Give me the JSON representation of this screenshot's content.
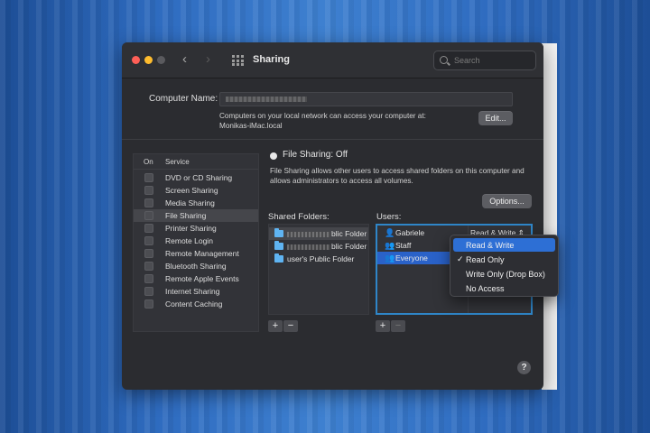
{
  "window": {
    "title": "Sharing",
    "search_placeholder": "Search"
  },
  "computer_name": {
    "label": "Computer Name:",
    "value": "",
    "description_line1": "Computers on your local network can access your computer at:",
    "description_line2": "Monikas-iMac.local",
    "edit_label": "Edit..."
  },
  "services": {
    "header_on": "On",
    "header_service": "Service",
    "items": [
      {
        "label": "DVD or CD Sharing",
        "on": false
      },
      {
        "label": "Screen Sharing",
        "on": false
      },
      {
        "label": "Media Sharing",
        "on": false
      },
      {
        "label": "File Sharing",
        "on": false,
        "selected": true
      },
      {
        "label": "Printer Sharing",
        "on": false
      },
      {
        "label": "Remote Login",
        "on": false
      },
      {
        "label": "Remote Management",
        "on": false
      },
      {
        "label": "Bluetooth Sharing",
        "on": false
      },
      {
        "label": "Remote Apple Events",
        "on": false
      },
      {
        "label": "Internet Sharing",
        "on": false
      },
      {
        "label": "Content Caching",
        "on": false
      }
    ]
  },
  "file_sharing": {
    "status": "File Sharing: Off",
    "description_line1": "File Sharing allows other users to access shared folders on this computer and",
    "description_line2": "allows administrators to access all volumes.",
    "options_label": "Options..."
  },
  "shared_folders": {
    "label": "Shared Folders:",
    "items": [
      {
        "label": "blic Folder"
      },
      {
        "label": "blic Folder"
      },
      {
        "label": "user's Public Folder"
      }
    ]
  },
  "users": {
    "label": "Users:",
    "items": [
      {
        "label": "Gabriele",
        "icon": "user-icon",
        "permission": "Read & Write ⇕"
      },
      {
        "label": "Staff",
        "icon": "group-icon"
      },
      {
        "label": "Everyone",
        "icon": "group-icon",
        "selected": true
      }
    ]
  },
  "buttons": {
    "add": "+",
    "remove": "−",
    "help": "?"
  },
  "permission_menu": {
    "items": [
      {
        "label": "Read & Write",
        "highlighted": true,
        "checked": false
      },
      {
        "label": "Read Only",
        "highlighted": false,
        "checked": true
      },
      {
        "label": "Write Only (Drop Box)",
        "highlighted": false,
        "checked": false
      },
      {
        "label": "No Access",
        "highlighted": false,
        "checked": false
      }
    ],
    "check_mark": "✓"
  },
  "colors": {
    "accent": "#2d6fd5",
    "selection_border": "#2f86c8",
    "folder": "#5fb4f2",
    "window_bg": "#2b2c30"
  }
}
